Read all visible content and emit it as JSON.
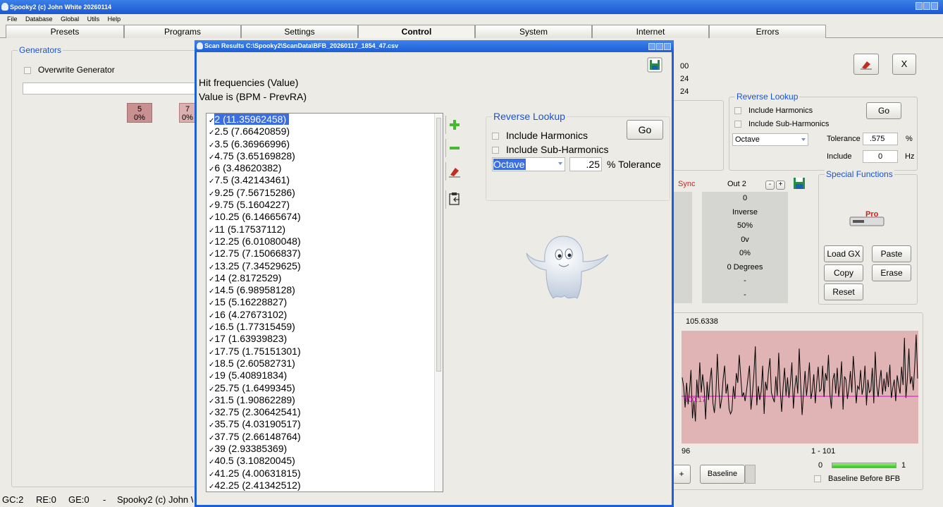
{
  "window": {
    "title": "Spooky2 (c) John White 20260114"
  },
  "menu": [
    "File",
    "Database",
    "Global",
    "Utils",
    "Help"
  ],
  "tabs": [
    {
      "label": "Presets",
      "active": false
    },
    {
      "label": "Programs",
      "active": false
    },
    {
      "label": "Settings",
      "active": false
    },
    {
      "label": "Control",
      "active": true
    },
    {
      "label": "System",
      "active": false
    },
    {
      "label": "Internet",
      "active": false
    },
    {
      "label": "Errors",
      "active": false
    }
  ],
  "generators": {
    "title": "Generators",
    "overwrite_label": "Overwrite Generator",
    "gen_a": {
      "num": "5",
      "pct": "0%"
    },
    "gen_b": {
      "num": "7",
      "pct": "0%"
    }
  },
  "bg_values": [
    "00",
    "24",
    "24"
  ],
  "bg_reverse": {
    "title": "Reverse Lookup",
    "include_harmonics": "Include Harmonics",
    "include_sub_harmonics": "Include Sub-Harmonics",
    "go": "Go",
    "mode": "Octave",
    "tolerance_label": "Tolerance",
    "tolerance_value": ".575",
    "tolerance_unit": "%",
    "include_label": "Include",
    "include_value": "0",
    "include_unit": "Hz"
  },
  "bg_close": "X",
  "out_panel": {
    "sync": "Sync",
    "out2": "Out 2",
    "minus": "-",
    "plus": "+",
    "values": [
      "0",
      "Inverse",
      "50%",
      "0v",
      "0%",
      "0 Degrees",
      "-",
      "-"
    ]
  },
  "special": {
    "title": "Special Functions",
    "logo_text": "Pro",
    "load_gx": "Load GX",
    "paste": "Paste",
    "copy": "Copy",
    "erase": "Erase",
    "reset": "Reset"
  },
  "graph": {
    "top_value": "105.6338",
    "line_label": "100.17",
    "x_left": "96",
    "x_right": "1 - 101",
    "progress_min": "0",
    "progress_max": "1",
    "progress_value": 1,
    "plus_label": "+",
    "baseline_button": "Baseline",
    "baseline_before_bfb": "Baseline Before BFB",
    "colors": {
      "bg": "#e0b4b4",
      "line": "#000000",
      "baseline": "#e000e0"
    },
    "signal": [
      59,
      50,
      31,
      54,
      34,
      47,
      66,
      21,
      37,
      18,
      57,
      40,
      73,
      45,
      62,
      49,
      20,
      55,
      38,
      56,
      68,
      35,
      26,
      42,
      81,
      48,
      30,
      39,
      58,
      70,
      44,
      53,
      30,
      25,
      28,
      51,
      39,
      63,
      54,
      80,
      60,
      41,
      45,
      37,
      47,
      59,
      70,
      29,
      44,
      62,
      88,
      33,
      51,
      38,
      46,
      70,
      25,
      55,
      47,
      65,
      77,
      45,
      40,
      36,
      60,
      42,
      82,
      48,
      27,
      50,
      68,
      42,
      59,
      40,
      54,
      73,
      30,
      49,
      61,
      44,
      86,
      53,
      24,
      45,
      65,
      42,
      55,
      73,
      39,
      47,
      62,
      35,
      55,
      69,
      46,
      48,
      70,
      41,
      63,
      56,
      80,
      44,
      30,
      57,
      63,
      44,
      68,
      41,
      52,
      74,
      29,
      60,
      57,
      39,
      49,
      65,
      45,
      79,
      59,
      35,
      51,
      48,
      66,
      43,
      50,
      70,
      33,
      57,
      45,
      47,
      68,
      35,
      83,
      52,
      41,
      56,
      66,
      43,
      58,
      46,
      64,
      50,
      71,
      40,
      49,
      57,
      37,
      61,
      52,
      44,
      69,
      52,
      96,
      40,
      58,
      86,
      53,
      60,
      47,
      70,
      99,
      58
    ]
  },
  "status": [
    "GC:2",
    "RE:0",
    "GE:0",
    "-",
    "Spooky2 (c) John W"
  ],
  "dialog": {
    "title": "Scan Results C:\\Spooky2\\ScanData\\BFB_20260117_1854_47.csv",
    "heading": "Hit frequencies (Value)",
    "subheading": "Value is (BPM - PrevRA)",
    "reverse": {
      "title": "Reverse Lookup",
      "include_harmonics": "Include Harmonics",
      "include_sub_harmonics": "Include Sub-Harmonics",
      "go": "Go",
      "mode": "Octave",
      "tolerance_value": ".25",
      "tolerance_label": "% Tolerance"
    },
    "items": [
      "2  (11.35962458)",
      "2.5  (7.66420859)",
      "3.5  (6.36966996)",
      "4.75  (3.65169828)",
      "6  (3.48620382)",
      "7.5  (3.42143461)",
      "9.25  (7.56715286)",
      "9.75  (5.1604227)",
      "10.25  (6.14665674)",
      "11  (5.17537112)",
      "12.25  (6.01080048)",
      "12.75  (7.15066837)",
      "13.25  (7.34529625)",
      "14  (2.8172529)",
      "14.5  (6.98958128)",
      "15  (5.16228827)",
      "16  (4.27673102)",
      "16.5  (1.77315459)",
      "17  (1.63939823)",
      "17.75  (1.75151301)",
      "18.5  (2.60582731)",
      "19  (5.40891834)",
      "25.75  (1.6499345)",
      "31.5  (1.90862289)",
      "32.75  (2.30642541)",
      "35.75  (4.03190517)",
      "37.75  (2.66148764)",
      "39  (2.93385369)",
      "40.5  (3.10820045)",
      "41.25  (4.00631815)",
      "42.25  (2.41342512)"
    ]
  }
}
